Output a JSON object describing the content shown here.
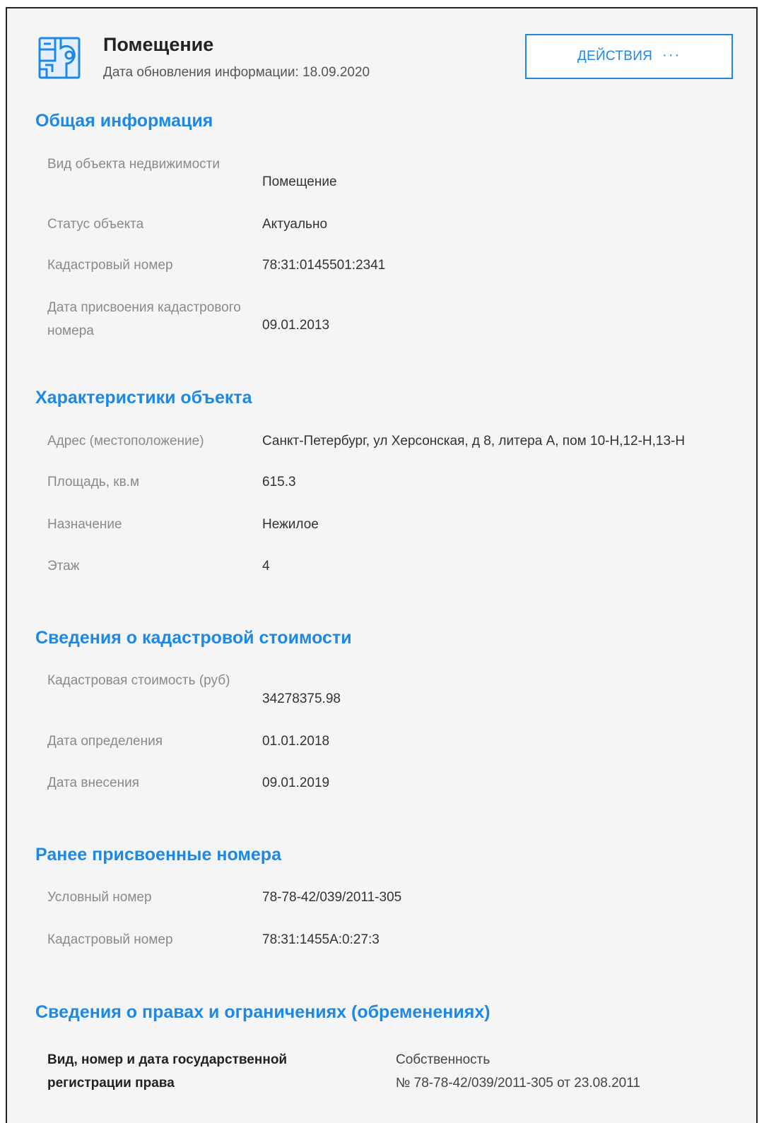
{
  "header": {
    "title": "Помещение",
    "updated_label": "Дата обновления информации:",
    "updated_date": "18.09.2020",
    "actions_label": "ДЕЙСТВИЯ",
    "actions_dots": "···",
    "icon": "building-plan-icon",
    "accent_color": "#1e88e5"
  },
  "sections": {
    "general": {
      "title": "Общая информация",
      "rows": [
        {
          "label": "Вид объекта недвижимости",
          "value": "Помещение"
        },
        {
          "label": "Статус объекта",
          "value": "Актуально"
        },
        {
          "label": "Кадастровый номер",
          "value": "78:31:0145501:2341"
        },
        {
          "label": "Дата присвоения кадастрового номера",
          "value": "09.01.2013"
        }
      ]
    },
    "characteristics": {
      "title": "Характеристики объекта",
      "rows": [
        {
          "label": "Адрес (местоположение)",
          "value": "Санкт-Петербург, ул Херсонская, д 8, литера А, пом 10-Н,12-Н,13-Н"
        },
        {
          "label": "Площадь, кв.м",
          "value": "615.3"
        },
        {
          "label": "Назначение",
          "value": "Нежилое"
        },
        {
          "label": "Этаж",
          "value": "4"
        }
      ]
    },
    "cadastral_value": {
      "title": "Сведения о кадастровой стоимости",
      "rows": [
        {
          "label": "Кадастровая стоимость (руб)",
          "value": "34278375.98"
        },
        {
          "label": "Дата определения",
          "value": "01.01.2018"
        },
        {
          "label": "Дата внесения",
          "value": "09.01.2019"
        }
      ]
    },
    "previous_numbers": {
      "title": "Ранее присвоенные номера",
      "rows": [
        {
          "label": "Условный номер",
          "value": "78-78-42/039/2011-305"
        },
        {
          "label": "Кадастровый номер",
          "value": "78:31:1455А:0:27:3"
        }
      ]
    },
    "rights": {
      "title": "Сведения о правах и ограничениях (обременениях)",
      "label": "Вид, номер и дата государственной регистрации права",
      "value_type": "Собственность",
      "value_number": "№ 78-78-42/039/2011-305 от 23.08.2011"
    }
  }
}
